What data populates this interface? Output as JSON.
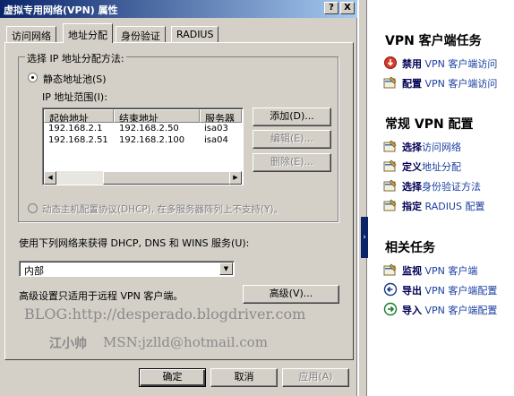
{
  "window": {
    "title": "虚拟专用网络(VPN) 属性",
    "help_btn": "?",
    "close_btn": "X"
  },
  "tabs": [
    {
      "label": "访问网络",
      "active": false
    },
    {
      "label": "地址分配",
      "active": true
    },
    {
      "label": "身份验证",
      "active": false
    },
    {
      "label": "RADIUS",
      "active": false
    }
  ],
  "group": {
    "legend": "选择 IP 地址分配方法:",
    "static_radio": "静态地址池(S)",
    "range_label": "IP 地址范围(I):",
    "columns": [
      "起始地址",
      "结束地址",
      "服务器"
    ],
    "rows": [
      [
        "192.168.2.1",
        "192.168.2.50",
        "isa03"
      ],
      [
        "192.168.2.51",
        "192.168.2.100",
        "isa04"
      ]
    ],
    "add_btn": "添加(D)...",
    "edit_btn": "编辑(E)...",
    "delete_btn": "删除(E)...",
    "dhcp_radio": "动态主机配置协议(DHCP), 在多服务器阵列上不支持(Y)。"
  },
  "network": {
    "label": "使用下列网络来获得 DHCP, DNS 和 WINS 服务(U):",
    "selected": "内部"
  },
  "advanced": {
    "label": "高级设置只适用于远程 VPN 客户端。",
    "button": "高级(V)..."
  },
  "watermark": {
    "blog": "BLOG:http://desperado.blogdriver.com",
    "author": "江小帅",
    "msn": "MSN:jzlld@hotmail.com"
  },
  "footer": {
    "ok": "确定",
    "cancel": "取消",
    "apply": "应用(A)"
  },
  "taskpane": {
    "sections": [
      {
        "title": "VPN 客户端任务",
        "tasks": [
          {
            "verb": "禁用",
            "text": "VPN 客户端访问",
            "icon": "disable-icon"
          },
          {
            "verb": "配置",
            "text": "VPN 客户端访问",
            "icon": "configure-icon"
          }
        ]
      },
      {
        "title": "常规 VPN 配置",
        "tasks": [
          {
            "verb": "选择",
            "text": "访问网络",
            "icon": "configure-icon"
          },
          {
            "verb": "定义",
            "text": "地址分配",
            "icon": "configure-icon"
          },
          {
            "verb": "选择",
            "text": "身份验证方法",
            "icon": "configure-icon"
          },
          {
            "verb": "指定",
            "text": "RADIUS 配置",
            "icon": "configure-icon"
          }
        ]
      },
      {
        "title": "相关任务",
        "tasks": [
          {
            "verb": "监视",
            "text": "VPN 客户端",
            "icon": "monitor-icon"
          },
          {
            "verb": "导出",
            "text": "VPN 客户端配置",
            "icon": "export-icon"
          },
          {
            "verb": "导入",
            "text": "VPN 客户端配置",
            "icon": "import-icon"
          }
        ]
      }
    ]
  },
  "colors": {
    "title_start": "#0a246a",
    "title_end": "#a6caf0",
    "dialog_face": "#d4d0c8",
    "link_blue": "#1a3fa0"
  }
}
